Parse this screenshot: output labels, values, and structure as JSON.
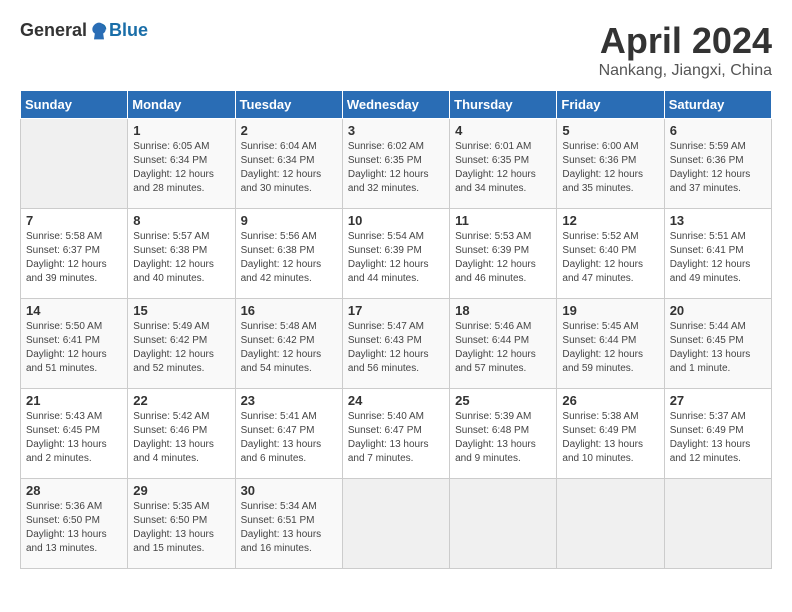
{
  "header": {
    "logo_general": "General",
    "logo_blue": "Blue",
    "month_title": "April 2024",
    "location": "Nankang, Jiangxi, China"
  },
  "days_of_week": [
    "Sunday",
    "Monday",
    "Tuesday",
    "Wednesday",
    "Thursday",
    "Friday",
    "Saturday"
  ],
  "weeks": [
    [
      {
        "day": "",
        "info": ""
      },
      {
        "day": "1",
        "info": "Sunrise: 6:05 AM\nSunset: 6:34 PM\nDaylight: 12 hours\nand 28 minutes."
      },
      {
        "day": "2",
        "info": "Sunrise: 6:04 AM\nSunset: 6:34 PM\nDaylight: 12 hours\nand 30 minutes."
      },
      {
        "day": "3",
        "info": "Sunrise: 6:02 AM\nSunset: 6:35 PM\nDaylight: 12 hours\nand 32 minutes."
      },
      {
        "day": "4",
        "info": "Sunrise: 6:01 AM\nSunset: 6:35 PM\nDaylight: 12 hours\nand 34 minutes."
      },
      {
        "day": "5",
        "info": "Sunrise: 6:00 AM\nSunset: 6:36 PM\nDaylight: 12 hours\nand 35 minutes."
      },
      {
        "day": "6",
        "info": "Sunrise: 5:59 AM\nSunset: 6:36 PM\nDaylight: 12 hours\nand 37 minutes."
      }
    ],
    [
      {
        "day": "7",
        "info": "Sunrise: 5:58 AM\nSunset: 6:37 PM\nDaylight: 12 hours\nand 39 minutes."
      },
      {
        "day": "8",
        "info": "Sunrise: 5:57 AM\nSunset: 6:38 PM\nDaylight: 12 hours\nand 40 minutes."
      },
      {
        "day": "9",
        "info": "Sunrise: 5:56 AM\nSunset: 6:38 PM\nDaylight: 12 hours\nand 42 minutes."
      },
      {
        "day": "10",
        "info": "Sunrise: 5:54 AM\nSunset: 6:39 PM\nDaylight: 12 hours\nand 44 minutes."
      },
      {
        "day": "11",
        "info": "Sunrise: 5:53 AM\nSunset: 6:39 PM\nDaylight: 12 hours\nand 46 minutes."
      },
      {
        "day": "12",
        "info": "Sunrise: 5:52 AM\nSunset: 6:40 PM\nDaylight: 12 hours\nand 47 minutes."
      },
      {
        "day": "13",
        "info": "Sunrise: 5:51 AM\nSunset: 6:41 PM\nDaylight: 12 hours\nand 49 minutes."
      }
    ],
    [
      {
        "day": "14",
        "info": "Sunrise: 5:50 AM\nSunset: 6:41 PM\nDaylight: 12 hours\nand 51 minutes."
      },
      {
        "day": "15",
        "info": "Sunrise: 5:49 AM\nSunset: 6:42 PM\nDaylight: 12 hours\nand 52 minutes."
      },
      {
        "day": "16",
        "info": "Sunrise: 5:48 AM\nSunset: 6:42 PM\nDaylight: 12 hours\nand 54 minutes."
      },
      {
        "day": "17",
        "info": "Sunrise: 5:47 AM\nSunset: 6:43 PM\nDaylight: 12 hours\nand 56 minutes."
      },
      {
        "day": "18",
        "info": "Sunrise: 5:46 AM\nSunset: 6:44 PM\nDaylight: 12 hours\nand 57 minutes."
      },
      {
        "day": "19",
        "info": "Sunrise: 5:45 AM\nSunset: 6:44 PM\nDaylight: 12 hours\nand 59 minutes."
      },
      {
        "day": "20",
        "info": "Sunrise: 5:44 AM\nSunset: 6:45 PM\nDaylight: 13 hours\nand 1 minute."
      }
    ],
    [
      {
        "day": "21",
        "info": "Sunrise: 5:43 AM\nSunset: 6:45 PM\nDaylight: 13 hours\nand 2 minutes."
      },
      {
        "day": "22",
        "info": "Sunrise: 5:42 AM\nSunset: 6:46 PM\nDaylight: 13 hours\nand 4 minutes."
      },
      {
        "day": "23",
        "info": "Sunrise: 5:41 AM\nSunset: 6:47 PM\nDaylight: 13 hours\nand 6 minutes."
      },
      {
        "day": "24",
        "info": "Sunrise: 5:40 AM\nSunset: 6:47 PM\nDaylight: 13 hours\nand 7 minutes."
      },
      {
        "day": "25",
        "info": "Sunrise: 5:39 AM\nSunset: 6:48 PM\nDaylight: 13 hours\nand 9 minutes."
      },
      {
        "day": "26",
        "info": "Sunrise: 5:38 AM\nSunset: 6:49 PM\nDaylight: 13 hours\nand 10 minutes."
      },
      {
        "day": "27",
        "info": "Sunrise: 5:37 AM\nSunset: 6:49 PM\nDaylight: 13 hours\nand 12 minutes."
      }
    ],
    [
      {
        "day": "28",
        "info": "Sunrise: 5:36 AM\nSunset: 6:50 PM\nDaylight: 13 hours\nand 13 minutes."
      },
      {
        "day": "29",
        "info": "Sunrise: 5:35 AM\nSunset: 6:50 PM\nDaylight: 13 hours\nand 15 minutes."
      },
      {
        "day": "30",
        "info": "Sunrise: 5:34 AM\nSunset: 6:51 PM\nDaylight: 13 hours\nand 16 minutes."
      },
      {
        "day": "",
        "info": ""
      },
      {
        "day": "",
        "info": ""
      },
      {
        "day": "",
        "info": ""
      },
      {
        "day": "",
        "info": ""
      }
    ]
  ]
}
